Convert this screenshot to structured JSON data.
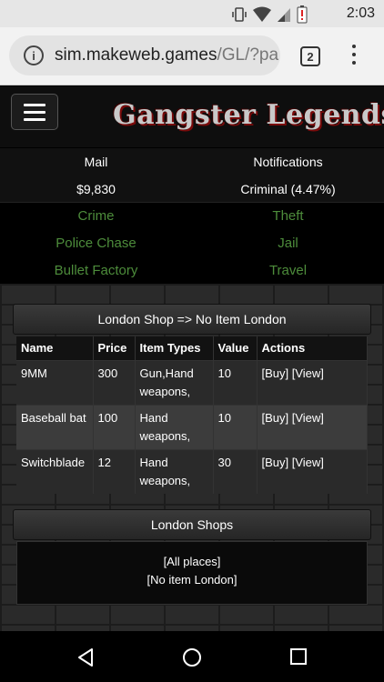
{
  "status_bar": {
    "time": "2:03",
    "icons": [
      "vibrate-icon",
      "wifi-icon",
      "signal-icon",
      "battery-alert-icon"
    ]
  },
  "browser": {
    "url_host": "sim.makeweb.games",
    "url_path": "/GL/?pa",
    "tab_count": "2"
  },
  "header": {
    "logo_text": "Gangster Legends",
    "mail": "Mail",
    "notifications": "Notifications",
    "money": "$9,830",
    "rank": "Criminal (4.47%)"
  },
  "nav": {
    "crime": "Crime",
    "theft": "Theft",
    "police_chase": "Police Chase",
    "jail": "Jail",
    "bullet_factory": "Bullet Factory",
    "travel": "Travel"
  },
  "shop": {
    "title": "London Shop => No Item London",
    "columns": [
      "Name",
      "Price",
      "Item Types",
      "Value",
      "Actions"
    ],
    "rows": [
      {
        "name": "9MM",
        "price": "300",
        "types": "Gun,Hand weapons,",
        "value": "10",
        "buy": "[Buy]",
        "view": "[View]"
      },
      {
        "name": "Baseball bat",
        "price": "100",
        "types": "Hand weapons,",
        "value": "10",
        "buy": "[Buy]",
        "view": "[View]"
      },
      {
        "name": "Switchblade",
        "price": "12",
        "types": "Hand weapons,",
        "value": "30",
        "buy": "[Buy]",
        "view": "[View]"
      }
    ]
  },
  "shops": {
    "title": "London Shops",
    "all_places": "[All places]",
    "no_item": "[No item London]"
  },
  "colors": {
    "nav_green": "#4d8c3b",
    "logo_red": "#7a0a0a"
  }
}
